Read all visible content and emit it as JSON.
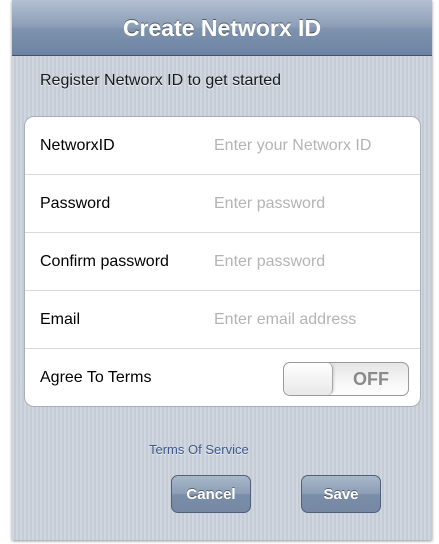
{
  "navbar": {
    "title": "Create Networx ID"
  },
  "subtitle": "Register Networx ID to get started",
  "form": {
    "rows": [
      {
        "label": "NetworxID",
        "placeholder": "Enter your Networx ID",
        "value": ""
      },
      {
        "label": "Password",
        "placeholder": "Enter password",
        "value": ""
      },
      {
        "label": "Confirm password",
        "placeholder": "Enter password",
        "value": ""
      },
      {
        "label": "Email",
        "placeholder": "Enter email address",
        "value": ""
      }
    ],
    "terms_toggle": {
      "label": "Agree To Terms",
      "state_text": "OFF"
    }
  },
  "terms_link": "Terms Of Service",
  "buttons": {
    "cancel": "Cancel",
    "save": "Save"
  },
  "colors": {
    "navbar": "#8c9eb7",
    "background": "#cbd2dc",
    "link": "#3a5a8c",
    "placeholder": "#b4b4b4"
  }
}
